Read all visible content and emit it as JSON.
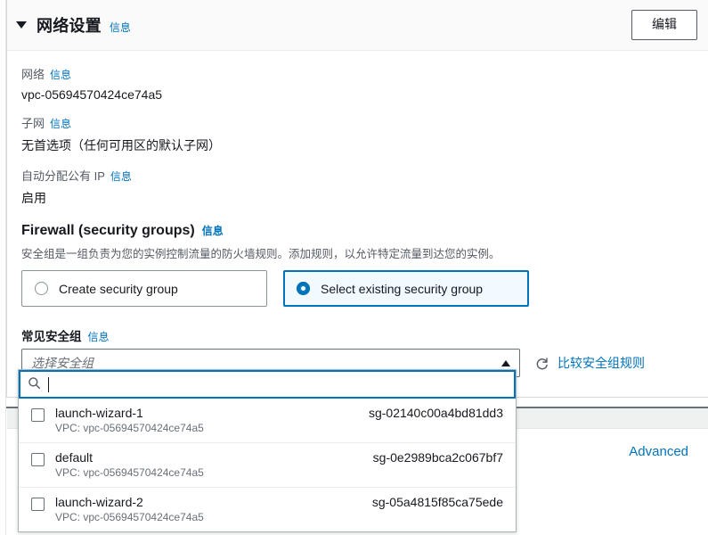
{
  "header": {
    "caret_icon": "caret-down-icon",
    "title": "网络设置",
    "info_label": "信息",
    "edit_button": "编辑"
  },
  "fields": [
    {
      "label": "网络",
      "info_label": "信息",
      "value": "vpc-05694570424ce74a5"
    },
    {
      "label": "子网",
      "info_label": "信息",
      "value": "无首选项（任何可用区的默认子网）"
    },
    {
      "label": "自动分配公有 IP",
      "info_label": "信息",
      "value": "启用"
    }
  ],
  "firewall": {
    "heading": "Firewall (security groups)",
    "info_label": "信息",
    "description": "安全组是一组负责为您的实例控制流量的防火墙规则。添加规则，以允许特定流量到达您的实例。",
    "options": [
      {
        "label": "Create security group",
        "selected": false
      },
      {
        "label": "Select existing security group",
        "selected": true
      }
    ]
  },
  "security_group_select": {
    "label": "常见安全组",
    "info_label": "信息",
    "placeholder": "选择安全组",
    "chevron_icon": "chevron-up-icon",
    "compare": {
      "icon": "refresh-icon",
      "label": "比较安全组规则"
    },
    "search": {
      "icon": "search-icon",
      "value": "",
      "placeholder": ""
    },
    "options": [
      {
        "name": "launch-wizard-1",
        "id": "sg-02140c00a4bd81dd3",
        "vpc": "VPC: vpc-05694570424ce74a5",
        "checked": false
      },
      {
        "name": "default",
        "id": "sg-0e2989bca2c067bf7",
        "vpc": "VPC: vpc-05694570424ce74a5",
        "checked": false
      },
      {
        "name": "launch-wizard-2",
        "id": "sg-05a4815f85ca75ede",
        "vpc": "VPC: vpc-05694570424ce74a5",
        "checked": false
      }
    ]
  },
  "lower": {
    "advanced_label": "Advanced"
  },
  "colors": {
    "accent_blue": "#0073bb",
    "link_blue": "#0073bb",
    "selected_tile_bg": "#f1faff",
    "header_bg": "#fafafa",
    "border_gray": "#d5dbdb",
    "text_primary": "#16191f",
    "text_secondary": "#545b64"
  }
}
